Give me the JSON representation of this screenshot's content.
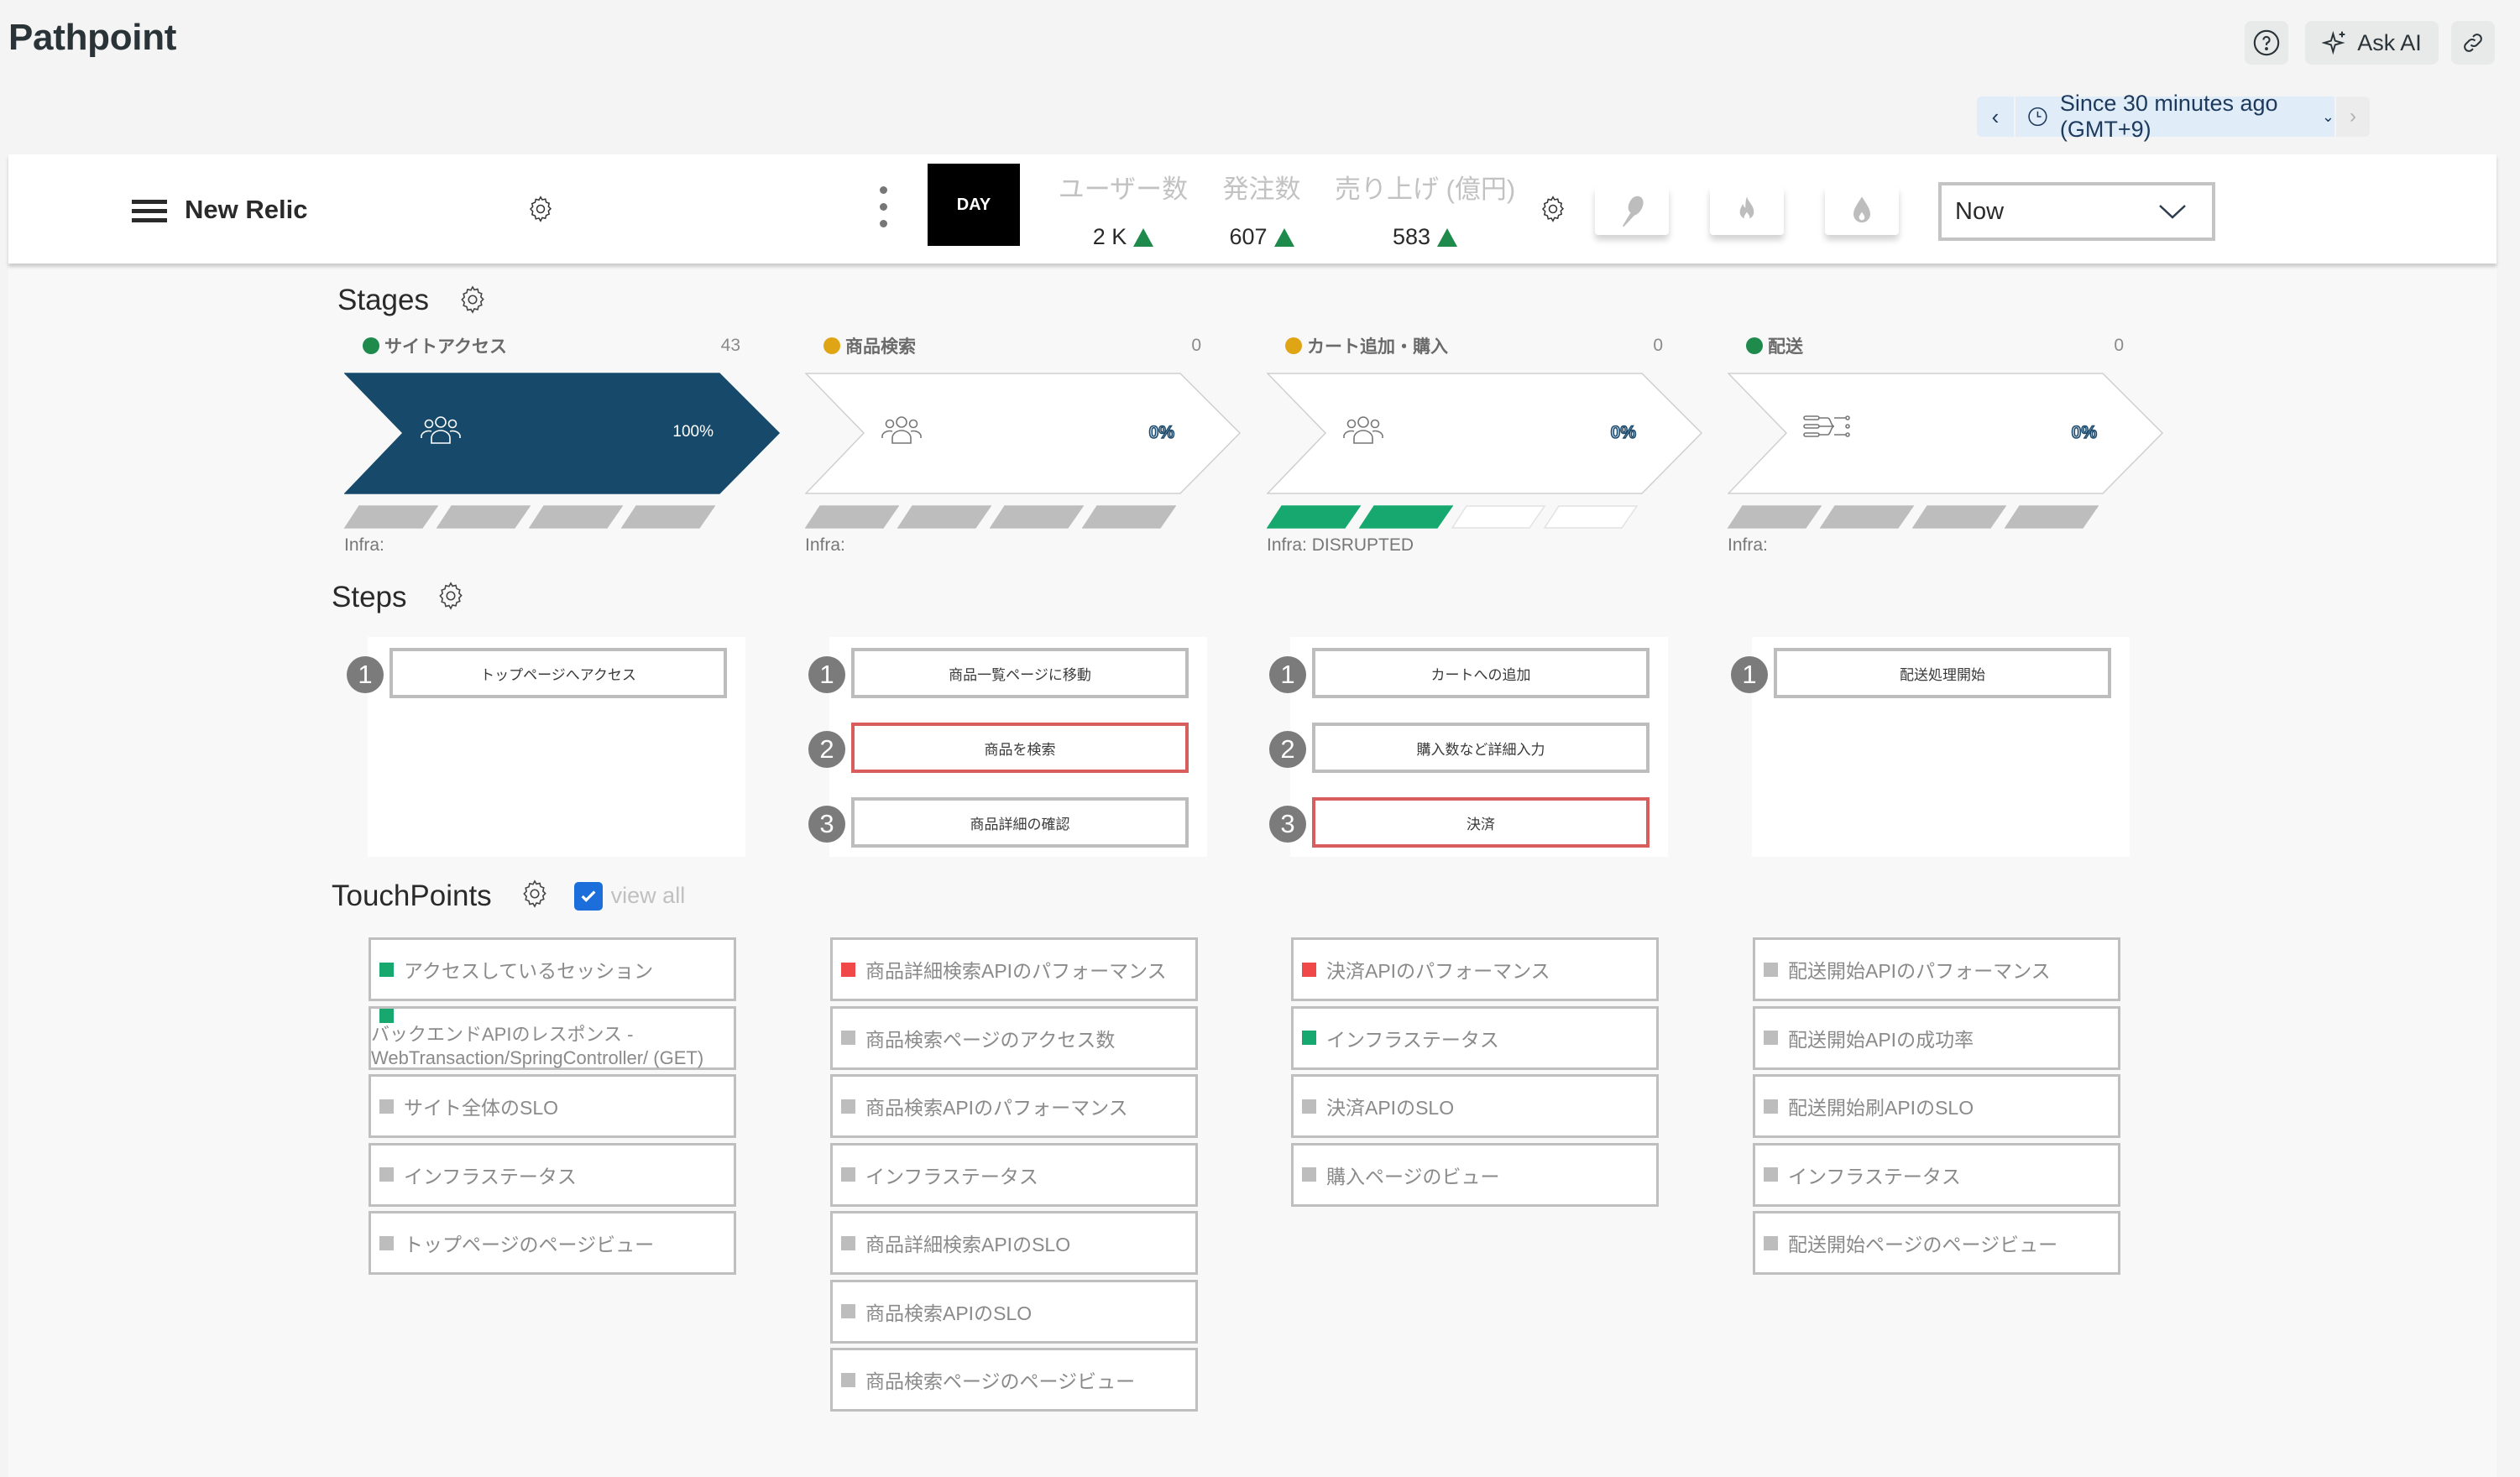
{
  "page": {
    "title": "Pathpoint",
    "help_icon": "help-circle-icon",
    "ask_ai_label": "Ask AI",
    "ask_ai_icon": "sparkle-icon",
    "link_icon": "link-icon"
  },
  "time_picker": {
    "prev": "‹",
    "label": "Since 30 minutes ago (GMT+9)",
    "caret": "⌄",
    "next": "›"
  },
  "header": {
    "brand": "New Relic",
    "day_label": "DAY",
    "kpis": [
      {
        "label": "ユーザー数",
        "value": "2 K",
        "trend": "up"
      },
      {
        "label": "発注数",
        "value": "607",
        "trend": "up"
      },
      {
        "label": "売り上げ (億円)",
        "value": "583",
        "trend": "up"
      }
    ],
    "tiles": [
      "canary-icon",
      "flame-icon",
      "water-drop-icon"
    ],
    "time_select": {
      "selected": "Now"
    }
  },
  "colors": {
    "stage_active": "#174a6a",
    "green": "#1e8a4c",
    "amber": "#e0a515",
    "infra_ok": "#17a86f",
    "infra_unknown": "#bdbdbd",
    "alert_red": "#f04848"
  },
  "stages": {
    "title": "Stages",
    "items": [
      {
        "name": "サイトアクセス",
        "status": "green",
        "count": "43",
        "percent": "100%",
        "active": true,
        "icon": "users-icon",
        "infra_label": "Infra:",
        "infra_bars": [
          "unknown",
          "unknown",
          "unknown",
          "unknown"
        ]
      },
      {
        "name": "商品検索",
        "status": "amber",
        "count": "0",
        "percent": "0%",
        "active": false,
        "icon": "users-icon",
        "infra_label": "Infra:",
        "infra_bars": [
          "unknown",
          "unknown",
          "unknown",
          "unknown"
        ]
      },
      {
        "name": "カート追加・購入",
        "status": "amber",
        "count": "0",
        "percent": "0%",
        "active": false,
        "icon": "users-icon",
        "infra_label": "Infra: DISRUPTED",
        "infra_bars": [
          "ok",
          "ok",
          "empty",
          "empty"
        ]
      },
      {
        "name": "配送",
        "status": "green",
        "count": "0",
        "percent": "0%",
        "active": false,
        "icon": "flow-icon",
        "infra_label": "Infra:",
        "infra_bars": [
          "unknown",
          "unknown",
          "unknown",
          "unknown"
        ]
      }
    ]
  },
  "steps": {
    "title": "Steps",
    "columns": [
      [
        {
          "num": "1",
          "label": "トップページへアクセス",
          "alert": false
        }
      ],
      [
        {
          "num": "1",
          "label": "商品一覧ページに移動",
          "alert": false
        },
        {
          "num": "2",
          "label": "商品を検索",
          "alert": true
        },
        {
          "num": "3",
          "label": "商品詳細の確認",
          "alert": false
        }
      ],
      [
        {
          "num": "1",
          "label": "カートへの追加",
          "alert": false
        },
        {
          "num": "2",
          "label": "購入数など詳細入力",
          "alert": false
        },
        {
          "num": "3",
          "label": "決済",
          "alert": true
        }
      ],
      [
        {
          "num": "1",
          "label": "配送処理開始",
          "alert": false
        }
      ]
    ]
  },
  "touchpoints": {
    "title": "TouchPoints",
    "view_all_label": "view all",
    "view_all_checked": true,
    "columns": [
      [
        {
          "label": "アクセスしているセッション",
          "status": "green"
        },
        {
          "label": "バックエンドAPIのレスポンス - WebTransaction/SpringController/ (GET)",
          "status": "green",
          "multiline": true
        },
        {
          "label": "サイト全体のSLO",
          "status": "gray"
        },
        {
          "label": "インフラステータス",
          "status": "gray"
        },
        {
          "label": "トップページのページビュー",
          "status": "gray"
        }
      ],
      [
        {
          "label": "商品詳細検索APIのパフォーマンス",
          "status": "red"
        },
        {
          "label": "商品検索ページのアクセス数",
          "status": "gray"
        },
        {
          "label": "商品検索APIのパフォーマンス",
          "status": "gray"
        },
        {
          "label": "インフラステータス",
          "status": "gray"
        },
        {
          "label": "商品詳細検索APIのSLO",
          "status": "gray"
        },
        {
          "label": "商品検索APIのSLO",
          "status": "gray"
        },
        {
          "label": "商品検索ページのページビュー",
          "status": "gray"
        }
      ],
      [
        {
          "label": "決済APIのパフォーマンス",
          "status": "red"
        },
        {
          "label": "インフラステータス",
          "status": "green"
        },
        {
          "label": "決済APIのSLO",
          "status": "gray"
        },
        {
          "label": "購入ページのビュー",
          "status": "gray"
        }
      ],
      [
        {
          "label": "配送開始APIのパフォーマンス",
          "status": "gray"
        },
        {
          "label": "配送開始APIの成功率",
          "status": "gray"
        },
        {
          "label": "配送開始刷APIのSLO",
          "status": "gray"
        },
        {
          "label": "インフラステータス",
          "status": "gray"
        },
        {
          "label": "配送開始ページのページビュー",
          "status": "gray"
        }
      ]
    ]
  }
}
